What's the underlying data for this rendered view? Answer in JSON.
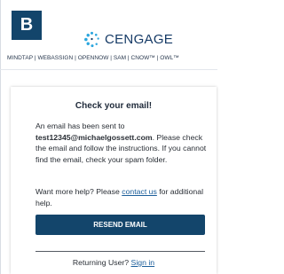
{
  "badge": {
    "label": "B"
  },
  "header": {
    "logo_text": "CENGAGE",
    "platforms": "MINDTAP | WEBASSIGN | OPENNOW | SAM | CNOW™ | OWL™"
  },
  "panel": {
    "title": "Check your email!",
    "intro_before": "An email has been sent to ",
    "email": "test12345@michaelgossett.com",
    "intro_after": ". Please check the email and follow the instructions. If you cannot find the email, check your spam folder.",
    "help_before": "Want more help? Please ",
    "help_link": "contact us",
    "help_after": " for additional help.",
    "resend_label": "RESEND EMAIL",
    "returning_text": "Returning User? ",
    "signin_link": "Sign in"
  },
  "colors": {
    "brand_navy": "#13456b",
    "link_blue": "#1b5e9a",
    "logo_dots": "#2ba6de"
  },
  "icons": {
    "logo_mark": "cengage-dots-icon"
  }
}
